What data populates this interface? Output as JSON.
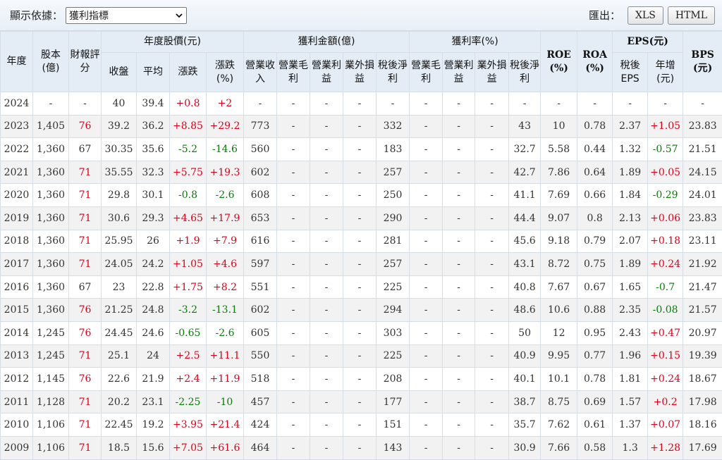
{
  "toolbar": {
    "display_label": "顯示依據：",
    "select_value": "獲利指標",
    "export_label": "匯出：",
    "xls": "XLS",
    "html": "HTML"
  },
  "headers": {
    "year": "年度",
    "capital": "股本(億)",
    "rating": "財報評分",
    "price_group": "年度股價(元)",
    "profit_group": "獲利金額(億)",
    "margin_group": "獲利率(%)",
    "roe": "ROE (%)",
    "roa": "ROA (%)",
    "eps_group": "EPS(元)",
    "bps": "BPS (元)",
    "close": "收盤",
    "avg": "平均",
    "change": "漲跌",
    "change_pct": "漲跌 (%)",
    "revenue": "營業收入",
    "gross": "營業毛利",
    "op_income": "營業利益",
    "nonop": "業外損益",
    "net": "稅後淨利",
    "m_gross": "營業毛利",
    "m_op": "營業利益",
    "m_nonop": "業外損益",
    "m_net": "稅後淨利",
    "eps": "稅後 EPS",
    "eps_yoy": "年增 (元)"
  },
  "colors": {
    "up": "#e0001b",
    "down": "#0a7a0a",
    "header_bg": "#e4ecf5"
  },
  "rows": [
    [
      "2024",
      "-",
      "-",
      "40",
      "39.4",
      "+0.8",
      "+2",
      "-",
      "-",
      "-",
      "-",
      "-",
      "-",
      "-",
      "-",
      "-",
      "-",
      "-",
      "-",
      "-",
      "-"
    ],
    [
      "2023",
      "1,405",
      "76",
      "39.2",
      "36.2",
      "+8.85",
      "+29.2",
      "773",
      "-",
      "-",
      "-",
      "332",
      "-",
      "-",
      "-",
      "43",
      "10",
      "0.78",
      "2.37",
      "+1.05",
      "23.83"
    ],
    [
      "2022",
      "1,360",
      "67",
      "30.35",
      "35.6",
      "-5.2",
      "-14.6",
      "560",
      "-",
      "-",
      "-",
      "183",
      "-",
      "-",
      "-",
      "32.7",
      "5.58",
      "0.44",
      "1.32",
      "-0.57",
      "21.51"
    ],
    [
      "2021",
      "1,360",
      "71",
      "35.55",
      "32.3",
      "+5.75",
      "+19.3",
      "602",
      "-",
      "-",
      "-",
      "257",
      "-",
      "-",
      "-",
      "42.7",
      "7.86",
      "0.64",
      "1.89",
      "+0.05",
      "24.15"
    ],
    [
      "2020",
      "1,360",
      "71",
      "29.8",
      "30.1",
      "-0.8",
      "-2.6",
      "608",
      "-",
      "-",
      "-",
      "250",
      "-",
      "-",
      "-",
      "41.1",
      "7.69",
      "0.66",
      "1.84",
      "-0.29",
      "24.01"
    ],
    [
      "2019",
      "1,360",
      "71",
      "30.6",
      "29.3",
      "+4.65",
      "+17.9",
      "653",
      "-",
      "-",
      "-",
      "290",
      "-",
      "-",
      "-",
      "44.4",
      "9.07",
      "0.8",
      "2.13",
      "+0.06",
      "23.83"
    ],
    [
      "2018",
      "1,360",
      "71",
      "25.95",
      "26",
      "+1.9",
      "+7.9",
      "616",
      "-",
      "-",
      "-",
      "281",
      "-",
      "-",
      "-",
      "45.6",
      "9.18",
      "0.79",
      "2.07",
      "+0.18",
      "23.11"
    ],
    [
      "2017",
      "1,360",
      "71",
      "24.05",
      "24.2",
      "+1.05",
      "+4.6",
      "597",
      "-",
      "-",
      "-",
      "257",
      "-",
      "-",
      "-",
      "43.1",
      "8.72",
      "0.75",
      "1.89",
      "+0.24",
      "21.92"
    ],
    [
      "2016",
      "1,360",
      "67",
      "23",
      "22.8",
      "+1.75",
      "+8.2",
      "551",
      "-",
      "-",
      "-",
      "225",
      "-",
      "-",
      "-",
      "40.8",
      "7.67",
      "0.67",
      "1.65",
      "-0.7",
      "21.47"
    ],
    [
      "2015",
      "1,360",
      "76",
      "21.25",
      "24.8",
      "-3.2",
      "-13.1",
      "602",
      "-",
      "-",
      "-",
      "294",
      "-",
      "-",
      "-",
      "48.6",
      "10.6",
      "0.88",
      "2.35",
      "-0.08",
      "21.57"
    ],
    [
      "2014",
      "1,245",
      "76",
      "24.45",
      "24.6",
      "-0.65",
      "-2.6",
      "605",
      "-",
      "-",
      "-",
      "303",
      "-",
      "-",
      "-",
      "50",
      "12",
      "0.95",
      "2.43",
      "+0.47",
      "20.97"
    ],
    [
      "2013",
      "1,245",
      "71",
      "25.1",
      "24",
      "+2.5",
      "+11.1",
      "550",
      "-",
      "-",
      "-",
      "225",
      "-",
      "-",
      "-",
      "40.9",
      "9.95",
      "0.77",
      "1.96",
      "+0.15",
      "19.39"
    ],
    [
      "2012",
      "1,145",
      "76",
      "22.6",
      "21.9",
      "+2.4",
      "+11.9",
      "518",
      "-",
      "-",
      "-",
      "208",
      "-",
      "-",
      "-",
      "40.1",
      "10.1",
      "0.78",
      "1.81",
      "+0.24",
      "18.67"
    ],
    [
      "2011",
      "1,128",
      "71",
      "20.2",
      "23.1",
      "-2.25",
      "-10",
      "457",
      "-",
      "-",
      "-",
      "177",
      "-",
      "-",
      "-",
      "38.7",
      "8.75",
      "0.69",
      "1.57",
      "+0.2",
      "17.98"
    ],
    [
      "2010",
      "1,106",
      "71",
      "22.45",
      "19.2",
      "+3.95",
      "+21.4",
      "424",
      "-",
      "-",
      "-",
      "151",
      "-",
      "-",
      "-",
      "35.7",
      "7.62",
      "0.61",
      "1.37",
      "+0.07",
      "18.16"
    ],
    [
      "2009",
      "1,106",
      "71",
      "18.5",
      "15.6",
      "+7.05",
      "+61.6",
      "464",
      "-",
      "-",
      "-",
      "143",
      "-",
      "-",
      "-",
      "30.9",
      "7.66",
      "0.58",
      "1.3",
      "+1.28",
      "17.69"
    ]
  ]
}
